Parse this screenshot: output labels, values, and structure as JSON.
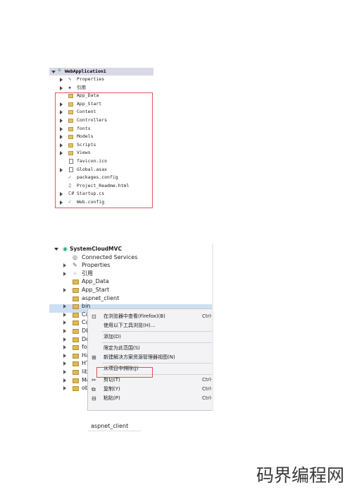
{
  "panel1": {
    "project": "WebApplication1",
    "items": [
      {
        "label": "Properties",
        "icon": "wrench-icon",
        "expander": true
      },
      {
        "label": "引用",
        "icon": "references-icon",
        "expander": true
      },
      {
        "label": "App_Data",
        "icon": "folder-icon",
        "expander": false
      },
      {
        "label": "App_Start",
        "icon": "folder-icon",
        "expander": true
      },
      {
        "label": "Content",
        "icon": "folder-icon",
        "expander": true
      },
      {
        "label": "Controllers",
        "icon": "folder-icon",
        "expander": true
      },
      {
        "label": "fonts",
        "icon": "folder-icon",
        "expander": true
      },
      {
        "label": "Models",
        "icon": "folder-icon",
        "expander": true
      },
      {
        "label": "Scripts",
        "icon": "folder-icon",
        "expander": true
      },
      {
        "label": "Views",
        "icon": "folder-icon",
        "expander": true
      },
      {
        "label": "favicon.ico",
        "icon": "file-icon",
        "expander": false
      },
      {
        "label": "Global.asax",
        "icon": "file-icon",
        "expander": true
      },
      {
        "label": "packages.config",
        "icon": "config-icon",
        "expander": false
      },
      {
        "label": "Project_Readme.html",
        "icon": "html-file-icon",
        "expander": false
      },
      {
        "label": "Startup.cs",
        "icon": "csharp-file-icon",
        "expander": true
      },
      {
        "label": "Web.config",
        "icon": "config-icon",
        "expander": true
      }
    ],
    "highlight_color": "#e0585e"
  },
  "panel2": {
    "project": "SystemCloudMVC",
    "items": [
      {
        "label": "Connected Services",
        "icon": "connected-services-icon",
        "expander": false
      },
      {
        "label": "Properties",
        "icon": "wrench-icon",
        "expander": true
      },
      {
        "label": "引用",
        "icon": "references-icon",
        "expander": true
      },
      {
        "label": "App_Data",
        "icon": "folder-icon",
        "expander": false
      },
      {
        "label": "App_Start",
        "icon": "folder-icon",
        "expander": true
      },
      {
        "label": "aspnet_client",
        "icon": "folder-icon",
        "expander": false
      },
      {
        "label": "bin",
        "icon": "folder-icon",
        "expander": true
      },
      {
        "label": "Co",
        "icon": "folder-icon",
        "expander": true
      },
      {
        "label": "Co",
        "icon": "folder-icon",
        "expander": true
      },
      {
        "label": "DL",
        "icon": "folder-icon",
        "expander": true
      },
      {
        "label": "Do",
        "icon": "folder-icon",
        "expander": true
      },
      {
        "label": "fo",
        "icon": "folder-icon",
        "expander": true
      },
      {
        "label": "Ha",
        "icon": "folder-icon",
        "expander": true
      },
      {
        "label": "HT",
        "icon": "folder-icon",
        "expander": true
      },
      {
        "label": "lib",
        "icon": "folder-icon",
        "expander": true
      },
      {
        "label": "Mo",
        "icon": "folder-icon",
        "expander": true
      },
      {
        "label": "ob",
        "icon": "folder-icon",
        "expander": true
      }
    ],
    "context_menu": [
      {
        "label": "在浏览器中查看(Firefox)(B)",
        "shortcut": "Ctrl-",
        "icon": "browser-icon"
      },
      {
        "label": "使用以下工具浏览(H)...",
        "shortcut": "",
        "icon": ""
      },
      {
        "sep": true
      },
      {
        "label": "添加(D)",
        "shortcut": "",
        "icon": ""
      },
      {
        "sep": true
      },
      {
        "label": "限定为此范围(S)",
        "shortcut": "",
        "icon": ""
      },
      {
        "label": "新建解决方案资源管理器视图(N)",
        "shortcut": "",
        "icon": "new-view-icon"
      },
      {
        "sep": true
      },
      {
        "label": "从项目中排除(J)",
        "shortcut": "",
        "icon": ""
      },
      {
        "sep": true
      },
      {
        "label": "剪切(T)",
        "shortcut": "Ctrl-",
        "icon": "cut-icon"
      },
      {
        "label": "复制(Y)",
        "shortcut": "Ctrl-",
        "icon": "copy-icon"
      },
      {
        "label": "粘贴(P)",
        "shortcut": "Ctrl-",
        "icon": "paste-icon"
      }
    ],
    "selection_color": "#cde0f3",
    "highlight_color": "#dd4e58"
  },
  "panel3": {
    "label": "aspnet_client"
  },
  "watermark": "码界编程网"
}
